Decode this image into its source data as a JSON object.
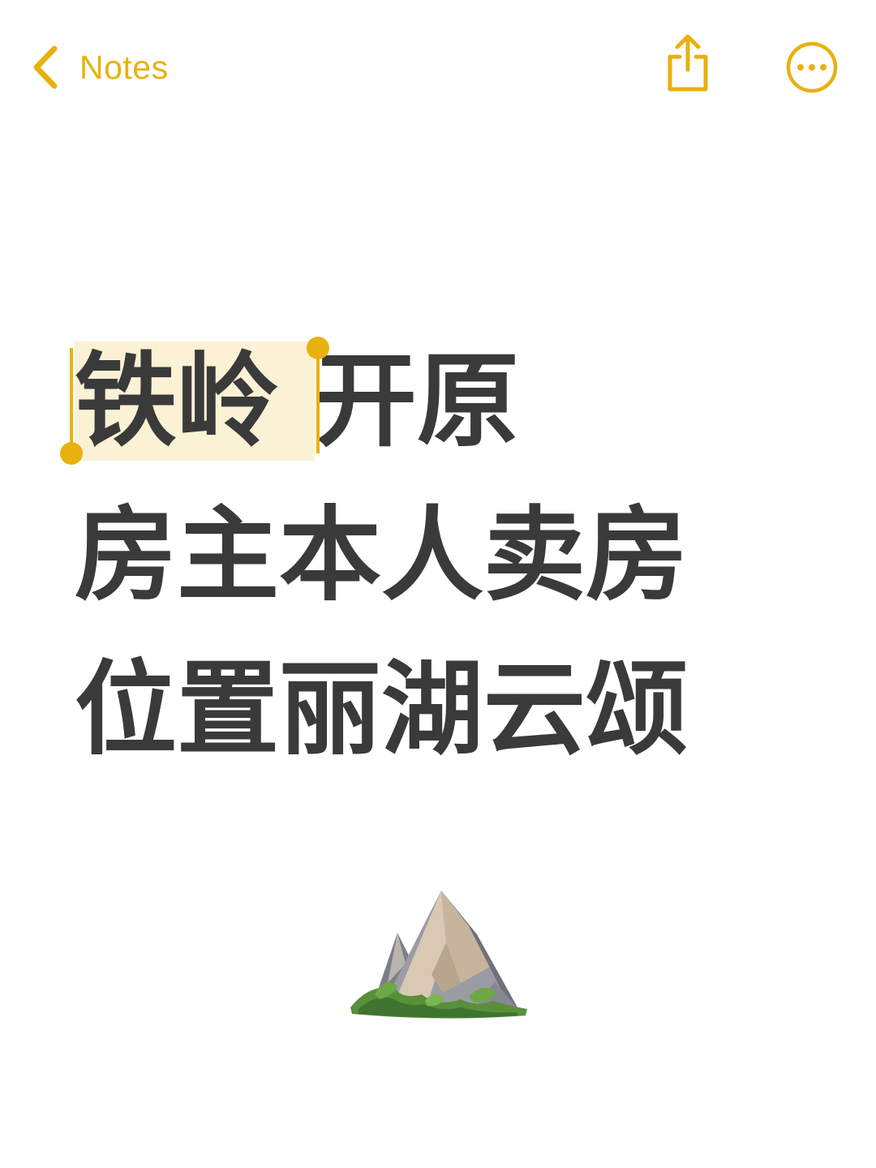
{
  "nav": {
    "back_label": "Notes",
    "back_icon": "chevron-left-icon",
    "share_icon": "share-icon",
    "more_icon": "ellipsis-circle-icon"
  },
  "note": {
    "lines": [
      {
        "selected": "铁岭",
        "rest": "开原"
      },
      {
        "text": "房主本人卖房"
      },
      {
        "text": "位置丽湖云颂"
      }
    ],
    "emoji": "mountain-emoji-icon"
  },
  "colors": {
    "accent": "#E9B10F",
    "text": "#3a3a3a",
    "selection_bg": "#FBF1D5",
    "background": "#ffffff"
  }
}
